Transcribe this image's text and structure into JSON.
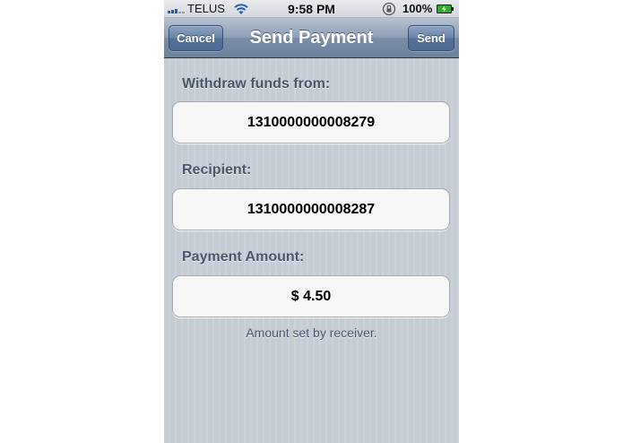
{
  "status_bar": {
    "carrier": "TELUS",
    "time": "9:58 PM",
    "battery": "100%",
    "icons": [
      "signal-icon",
      "wifi-icon",
      "rotation-lock-icon",
      "battery-icon"
    ]
  },
  "nav_bar": {
    "title": "Send Payment",
    "cancel_label": "Cancel",
    "send_label": "Send"
  },
  "form": {
    "withdraw_label": "Withdraw funds from:",
    "withdraw_value": "1310000000008279",
    "recipient_label": "Recipient:",
    "recipient_value": "1310000000008287",
    "amount_label": "Payment Amount:",
    "amount_value": "$ 4.50",
    "amount_note": "Amount set by receiver."
  },
  "colors": {
    "nav_bar": "#7b8ea8",
    "background": "#c5ccd4",
    "label_text": "#4c566c"
  }
}
